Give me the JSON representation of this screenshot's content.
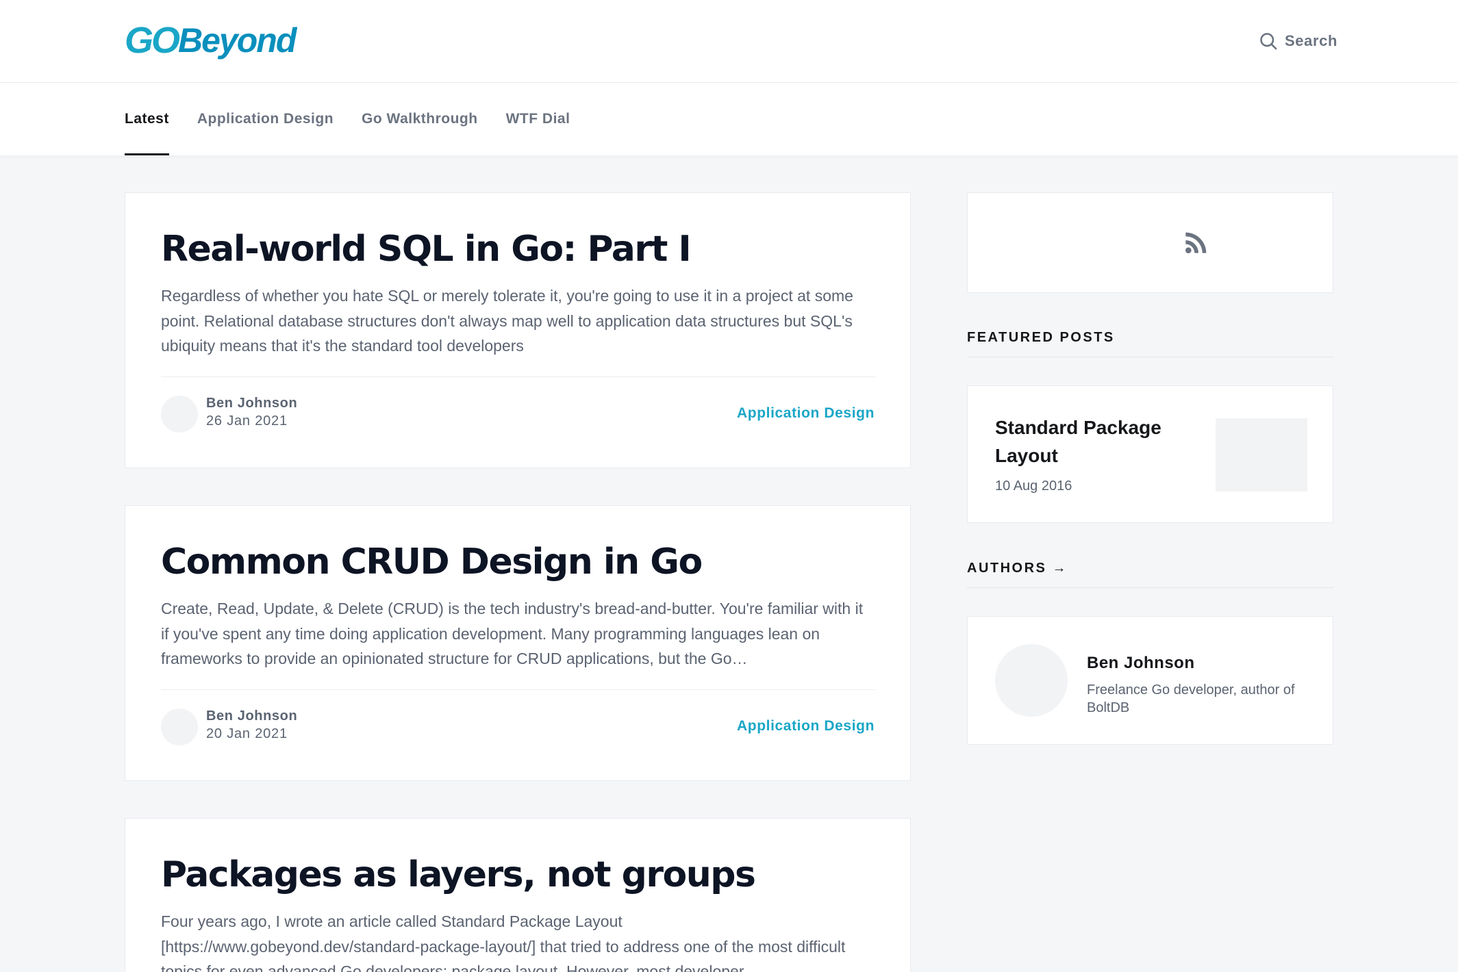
{
  "header": {
    "logo_go": "GO",
    "logo_beyond": "Beyond",
    "search_label": "Search"
  },
  "nav": {
    "items": [
      {
        "label": "Latest",
        "active": true
      },
      {
        "label": "Application Design",
        "active": false
      },
      {
        "label": "Go Walkthrough",
        "active": false
      },
      {
        "label": "WTF Dial",
        "active": false
      }
    ]
  },
  "posts": [
    {
      "title": "Real-world SQL in Go: Part I",
      "excerpt": "Regardless of whether you hate SQL or merely tolerate it, you're going to use it in a project at some point. Relational database structures don't always map well to application data structures but SQL's ubiquity means that it's the standard tool developers",
      "author": "Ben Johnson",
      "date": "26 Jan 2021",
      "tag": "Application Design"
    },
    {
      "title": "Common CRUD Design in Go",
      "excerpt": "Create, Read, Update, & Delete (CRUD) is the tech industry's bread-and-butter. You're familiar with it if you've spent any time doing application development. Many programming languages lean on frameworks to provide an opinionated structure for CRUD applications, but the Go…",
      "author": "Ben Johnson",
      "date": "20 Jan 2021",
      "tag": "Application Design"
    },
    {
      "title": "Packages as layers, not groups",
      "excerpt": "Four years ago, I wrote an article called Standard Package Layout [https://www.gobeyond.dev/standard-package-layout/] that tried to address one of the most difficult topics for even advanced Go developers: package layout. However, most developer",
      "author": "",
      "date": "",
      "tag": ""
    }
  ],
  "sidebar": {
    "rss_icon": "rss-icon",
    "featured_title": "FEATURED POSTS",
    "featured": {
      "title": "Standard Package Layout",
      "date": "10 Aug 2016"
    },
    "authors_title": "AUTHORS →",
    "author": {
      "name": "Ben Johnson",
      "bio": "Freelance Go developer, author of BoltDB"
    }
  },
  "colors": {
    "accent": "#1aa6c7",
    "heading": "#0d1424",
    "muted": "#5b6371",
    "background": "#f5f6f8"
  }
}
